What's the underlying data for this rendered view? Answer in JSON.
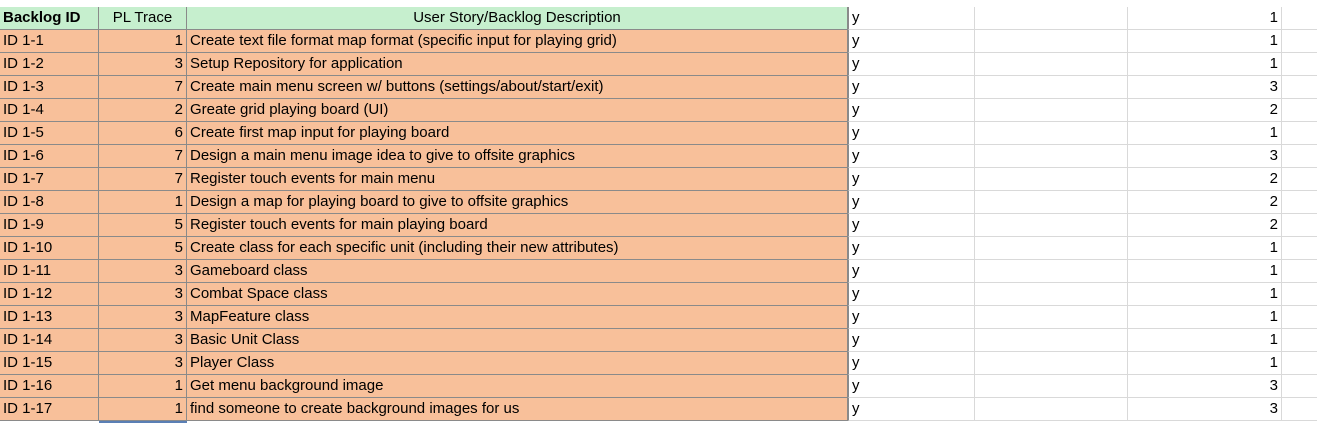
{
  "header": {
    "backlog_id": "Backlog ID",
    "pl_trace": "PL Trace",
    "description": "User Story/Backlog Description",
    "approved_value": "y",
    "priority_value": "1"
  },
  "rows": [
    {
      "id": "ID 1-1",
      "pl": "1",
      "desc": "Create text file format map format (specific input for playing grid)",
      "approved": "y",
      "priority": "1"
    },
    {
      "id": "ID 1-2",
      "pl": "3",
      "desc": "Setup Repository for application",
      "approved": "y",
      "priority": "1"
    },
    {
      "id": "ID 1-3",
      "pl": "7",
      "desc": "Create main menu screen w/ buttons (settings/about/start/exit)",
      "approved": "y",
      "priority": "3"
    },
    {
      "id": "ID 1-4",
      "pl": "2",
      "desc": "Greate grid playing board (UI)",
      "approved": "y",
      "priority": "2"
    },
    {
      "id": "ID 1-5",
      "pl": "6",
      "desc": "Create first map input for playing board",
      "approved": "y",
      "priority": "1"
    },
    {
      "id": "ID 1-6",
      "pl": "7",
      "desc": "Design a main menu image idea to give to offsite graphics",
      "approved": "y",
      "priority": "3"
    },
    {
      "id": "ID 1-7",
      "pl": "7",
      "desc": "Register touch events for main menu",
      "approved": "y",
      "priority": "2"
    },
    {
      "id": "ID 1-8",
      "pl": "1",
      "desc": "Design a map for playing board to give to offsite graphics",
      "approved": "y",
      "priority": "2"
    },
    {
      "id": "ID 1-9",
      "pl": "5",
      "desc": "Register touch events for main playing board",
      "approved": "y",
      "priority": "2"
    },
    {
      "id": "ID 1-10",
      "pl": "5",
      "desc": "Create class for each specific unit (including their new attributes)",
      "approved": "y",
      "priority": "1"
    },
    {
      "id": "ID 1-11",
      "pl": "3",
      "desc": "Gameboard class",
      "approved": "y",
      "priority": "1"
    },
    {
      "id": "ID 1-12",
      "pl": "3",
      "desc": "Combat Space class",
      "approved": "y",
      "priority": "1"
    },
    {
      "id": "ID 1-13",
      "pl": "3",
      "desc": "MapFeature class",
      "approved": "y",
      "priority": "1"
    },
    {
      "id": "ID 1-14",
      "pl": "3",
      "desc": "Basic Unit Class",
      "approved": "y",
      "priority": "1"
    },
    {
      "id": "ID 1-15",
      "pl": "3",
      "desc": "Player Class",
      "approved": "y",
      "priority": "1"
    },
    {
      "id": "ID 1-16",
      "pl": "1",
      "desc": "Get menu background image",
      "approved": "y",
      "priority": "3"
    },
    {
      "id": "ID 1-17",
      "pl": "1",
      "desc": "find someone to create background images for us",
      "approved": "y",
      "priority": "3"
    }
  ],
  "colors": {
    "row_fill": "#f8c09a",
    "header_fill": "#c6efce",
    "gridline": "#d9d9d9"
  }
}
